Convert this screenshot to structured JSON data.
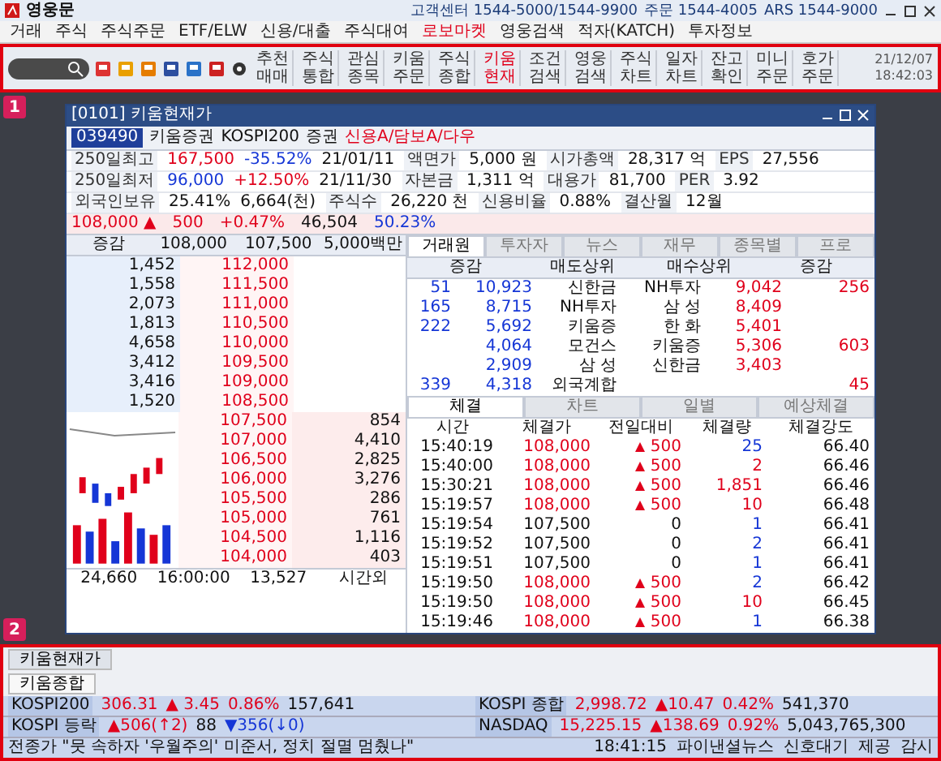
{
  "app": {
    "title": "영웅문",
    "contacts": [
      "고객센터 1544-5000/1544-9900",
      "주문 1544-4005",
      "ARS 1544-9000"
    ]
  },
  "menu": [
    {
      "label": "거래",
      "highlighted": false
    },
    {
      "label": "주식",
      "highlighted": false
    },
    {
      "label": "주식주문",
      "highlighted": false
    },
    {
      "label": "ETF/ELW",
      "highlighted": false
    },
    {
      "label": "신용/대출",
      "highlighted": false
    },
    {
      "label": "주식대여",
      "highlighted": false
    },
    {
      "label": "로보마켓",
      "highlighted": true
    },
    {
      "label": "영웅검색",
      "highlighted": false
    },
    {
      "label": "적자(KATCH)",
      "highlighted": false
    },
    {
      "label": "투자정보",
      "highlighted": false
    }
  ],
  "toolbar": {
    "buttons": [
      {
        "lines": [
          "추천",
          "매매"
        ],
        "highlighted": false
      },
      {
        "lines": [
          "주식",
          "통합"
        ],
        "highlighted": false
      },
      {
        "lines": [
          "관심",
          "종목"
        ],
        "highlighted": false
      },
      {
        "lines": [
          "키움",
          "주문"
        ],
        "highlighted": false
      },
      {
        "lines": [
          "주식",
          "종합"
        ],
        "highlighted": false
      },
      {
        "lines": [
          "키움",
          "현재"
        ],
        "highlighted": true
      },
      {
        "lines": [
          "조건",
          "검색"
        ],
        "highlighted": false
      },
      {
        "lines": [
          "영웅",
          "검색"
        ],
        "highlighted": false
      },
      {
        "lines": [
          "주식",
          "차트"
        ],
        "highlighted": false
      },
      {
        "lines": [
          "일자",
          "차트"
        ],
        "highlighted": false
      },
      {
        "lines": [
          "잔고",
          "확인"
        ],
        "highlighted": false
      },
      {
        "lines": [
          "미니",
          "주문"
        ],
        "highlighted": false
      },
      {
        "lines": [
          "호가",
          "주문"
        ],
        "highlighted": false
      }
    ],
    "date": "21/12/07",
    "time": "18:42:03"
  },
  "annotations": [
    "1",
    "2"
  ],
  "quote_window": {
    "title": "[0101] 키움현재가",
    "code": "039490",
    "name": "키움증권",
    "index": "KOSPI200",
    "sector": "증권",
    "tags": "신용A/담보A/다우",
    "info_rows": [
      [
        {
          "text": "250일최고",
          "kind": "label"
        },
        {
          "text": "167,500",
          "kind": "up"
        },
        {
          "text": "-35.52%",
          "kind": "down"
        },
        {
          "text": "21/01/11",
          "kind": "plain"
        },
        {
          "text": "액면가",
          "kind": "label"
        },
        {
          "text": "5,000 원",
          "kind": "plain"
        },
        {
          "text": "시가총액",
          "kind": "label"
        },
        {
          "text": "28,317 억",
          "kind": "plain"
        },
        {
          "text": "EPS",
          "kind": "label"
        },
        {
          "text": "27,556",
          "kind": "plain"
        }
      ],
      [
        {
          "text": "250일최저",
          "kind": "label"
        },
        {
          "text": "96,000",
          "kind": "down"
        },
        {
          "text": "+12.50%",
          "kind": "up"
        },
        {
          "text": "21/11/30",
          "kind": "plain"
        },
        {
          "text": "자본금",
          "kind": "label"
        },
        {
          "text": "1,311 억",
          "kind": "plain"
        },
        {
          "text": "대용가",
          "kind": "label"
        },
        {
          "text": "81,700",
          "kind": "plain"
        },
        {
          "text": "PER",
          "kind": "label"
        },
        {
          "text": "3.92",
          "kind": "plain"
        }
      ],
      [
        {
          "text": "외국인보유",
          "kind": "label"
        },
        {
          "text": "25.41%",
          "kind": "plain"
        },
        {
          "text": "6,664(천)",
          "kind": "plain"
        },
        {
          "text": "주식수",
          "kind": "label"
        },
        {
          "text": "26,220 천",
          "kind": "plain"
        },
        {
          "text": "신용비율",
          "kind": "label"
        },
        {
          "text": "0.88%",
          "kind": "plain"
        },
        {
          "text": "결산월",
          "kind": "label"
        },
        {
          "text": "12월",
          "kind": "plain"
        }
      ]
    ],
    "price": [
      {
        "text": "108,000 ▲",
        "kind": "up"
      },
      {
        "text": "500",
        "kind": "up"
      },
      {
        "text": "+0.47%",
        "kind": "up"
      },
      {
        "text": "46,504",
        "kind": "plain"
      },
      {
        "text": "50.23%",
        "kind": "down"
      }
    ],
    "book_header": [
      "증감",
      "108,000",
      "107,500",
      "5,000백만"
    ],
    "asks": [
      [
        "1,452",
        "112,000"
      ],
      [
        "1,558",
        "111,500"
      ],
      [
        "2,073",
        "111,000"
      ],
      [
        "1,813",
        "110,500"
      ],
      [
        "4,658",
        "110,000"
      ],
      [
        "3,412",
        "109,500"
      ],
      [
        "3,416",
        "109,000"
      ],
      [
        "1,520",
        "108,500"
      ]
    ],
    "bids": [
      [
        "107,500",
        "854"
      ],
      [
        "107,000",
        "4,410"
      ],
      [
        "106,500",
        "2,825"
      ],
      [
        "106,000",
        "3,276"
      ],
      [
        "105,500",
        "286"
      ],
      [
        "105,000",
        "761"
      ],
      [
        "104,500",
        "1,116"
      ],
      [
        "104,000",
        "403"
      ]
    ],
    "book_footer": [
      "24,660",
      "16:00:00",
      "13,527",
      "시간외"
    ],
    "broker_tabs": [
      {
        "label": "거래원",
        "selected": true
      },
      {
        "label": "투자자",
        "selected": false
      },
      {
        "label": "뉴스",
        "selected": false
      },
      {
        "label": "재무",
        "selected": false
      },
      {
        "label": "종목별",
        "selected": false
      },
      {
        "label": "프로",
        "selected": false
      }
    ],
    "broker_columns": [
      "증감",
      "매도상위",
      "매수상위",
      "증감"
    ],
    "broker_rows": [
      [
        "51",
        "10,923",
        "신한금",
        "NH투자",
        "9,042",
        "256"
      ],
      [
        "165",
        "8,715",
        "NH투자",
        "삼 성",
        "8,409",
        null
      ],
      [
        "222",
        "5,692",
        "키움증",
        "한 화",
        "5,401",
        null
      ],
      [
        null,
        "4,064",
        "모건스",
        "키움증",
        "5,306",
        "603"
      ],
      [
        null,
        "2,909",
        "삼 성",
        "신한금",
        "3,403",
        null
      ],
      [
        "339",
        "4,318",
        "외국계합",
        null,
        null,
        "45"
      ]
    ],
    "trade_tabs": [
      {
        "label": "체결",
        "selected": true
      },
      {
        "label": "차트",
        "selected": false
      },
      {
        "label": "일별",
        "selected": false
      },
      {
        "label": "예상체결",
        "selected": false
      }
    ],
    "trade_columns": [
      "시간",
      "체결가",
      "전일대비",
      "체결량",
      "체결강도"
    ],
    "trades": [
      {
        "time": "15:40:19",
        "price": "108,000",
        "rising": true,
        "diff": "500",
        "volume": "25",
        "buy": false,
        "strength": "66.40"
      },
      {
        "time": "15:40:00",
        "price": "108,000",
        "rising": true,
        "diff": "500",
        "volume": "2",
        "buy": true,
        "strength": "66.46"
      },
      {
        "time": "15:30:21",
        "price": "108,000",
        "rising": true,
        "diff": "500",
        "volume": "1,851",
        "buy": true,
        "strength": "66.46"
      },
      {
        "time": "15:19:57",
        "price": "108,000",
        "rising": true,
        "diff": "500",
        "volume": "10",
        "buy": true,
        "strength": "66.48"
      },
      {
        "time": "15:19:54",
        "price": "107,500",
        "rising": false,
        "diff": "0",
        "volume": "1",
        "buy": false,
        "strength": "66.41"
      },
      {
        "time": "15:19:52",
        "price": "107,500",
        "rising": false,
        "diff": "0",
        "volume": "2",
        "buy": false,
        "strength": "66.41"
      },
      {
        "time": "15:19:51",
        "price": "107,500",
        "rising": false,
        "diff": "0",
        "volume": "1",
        "buy": false,
        "strength": "66.41"
      },
      {
        "time": "15:19:50",
        "price": "108,000",
        "rising": true,
        "diff": "500",
        "volume": "2",
        "buy": false,
        "strength": "66.42"
      },
      {
        "time": "15:19:50",
        "price": "108,000",
        "rising": true,
        "diff": "500",
        "volume": "10",
        "buy": true,
        "strength": "66.45"
      },
      {
        "time": "15:19:46",
        "price": "108,000",
        "rising": true,
        "diff": "500",
        "volume": "1",
        "buy": false,
        "strength": "66.38"
      }
    ]
  },
  "bottom_panel": {
    "tabs": [
      {
        "label": "키움현재가",
        "selected": true
      },
      {
        "label": "키움종합",
        "selected": false
      }
    ],
    "tickers": [
      [
        {
          "text": "KOSPI200",
          "kind": "label"
        },
        {
          "text": "306.31",
          "kind": "up"
        },
        {
          "text": "▲ 3.45",
          "kind": "up"
        },
        {
          "text": "0.86%",
          "kind": "up"
        },
        {
          "text": "157,641",
          "kind": "plain"
        }
      ],
      [
        {
          "text": "KOSPI 종합",
          "kind": "label"
        },
        {
          "text": "2,998.72",
          "kind": "up"
        },
        {
          "text": "▲10.47",
          "kind": "up"
        },
        {
          "text": "0.42%",
          "kind": "up"
        },
        {
          "text": "541,370",
          "kind": "plain"
        }
      ],
      [
        {
          "text": "KOSPI 등락",
          "kind": "label"
        },
        {
          "text": "▲506(↑2)",
          "kind": "up"
        },
        {
          "text": "88",
          "kind": "plain"
        },
        {
          "text": "▼356(↓0)",
          "kind": "down"
        }
      ],
      [
        {
          "text": "NASDAQ",
          "kind": "label"
        },
        {
          "text": "15,225.15",
          "kind": "up"
        },
        {
          "text": "▲138.69",
          "kind": "up"
        },
        {
          "text": "0.92%",
          "kind": "up"
        },
        {
          "text": "5,043,765,300",
          "kind": "plain"
        }
      ]
    ],
    "news": "전종가 \"뭇 속하자 '우월주의' 미준서, 정치 절멸 멈췄나\"",
    "news_time": "18:41:15",
    "news_source": "파이낸셜뉴스",
    "signal": "신호대기",
    "provider": "제공",
    "watch": "감시"
  }
}
